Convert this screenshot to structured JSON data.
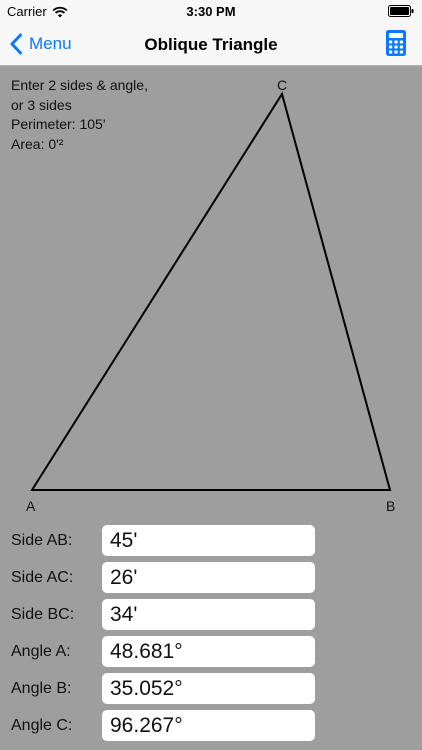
{
  "status_bar": {
    "carrier": "Carrier",
    "time": "3:30 PM"
  },
  "nav": {
    "back_label": "Menu",
    "title": "Oblique Triangle"
  },
  "info": {
    "line1": "Enter 2 sides & angle,",
    "line2": "or 3 sides",
    "perimeter": "Perimeter: 105'",
    "area": "Area: 0'²"
  },
  "triangle": {
    "vertex_a": "A",
    "vertex_b": "B",
    "vertex_c": "C"
  },
  "fields": [
    {
      "label": "Side AB:",
      "value": "45'"
    },
    {
      "label": "Side AC:",
      "value": "26'"
    },
    {
      "label": "Side BC:",
      "value": "34'"
    },
    {
      "label": "Angle A:",
      "value": "48.681°"
    },
    {
      "label": "Angle B:",
      "value": "35.052°"
    },
    {
      "label": "Angle C:",
      "value": "96.267°"
    }
  ],
  "colors": {
    "accent": "#0a7aff",
    "background": "#9e9e9e",
    "bar": "#f7f7f7"
  }
}
